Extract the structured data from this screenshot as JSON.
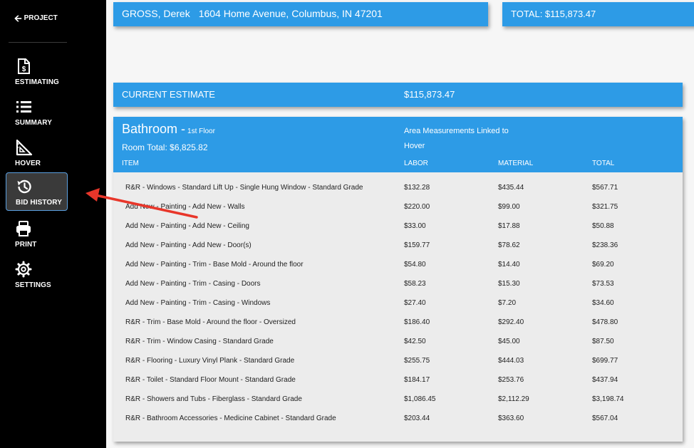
{
  "sidebar": {
    "back_label": "PROJECT",
    "items": [
      {
        "label": "ESTIMATING",
        "icon": "estimate-dollar-doc-icon",
        "active": false
      },
      {
        "label": "SUMMARY",
        "icon": "list-icon",
        "active": false
      },
      {
        "label": "HOVER",
        "icon": "ruler-triangle-icon",
        "active": false
      },
      {
        "label": "BID HISTORY",
        "icon": "history-clock-icon",
        "active": true
      },
      {
        "label": "PRINT",
        "icon": "printer-icon",
        "active": false
      },
      {
        "label": "SETTINGS",
        "icon": "gear-icon",
        "active": false
      }
    ]
  },
  "header": {
    "customer_name": "GROSS, Derek",
    "customer_address": "1604 Home Avenue, Columbus, IN 47201",
    "total_label": "TOTAL: $115,873.47"
  },
  "current_estimate": {
    "label": "CURRENT ESTIMATE",
    "value": "$115,873.47"
  },
  "room": {
    "name": "Bathroom -",
    "floor": "1st Floor",
    "total_label": "Room Total: $6,825.82",
    "area_note": "Area Measurements Linked to Hover",
    "columns": {
      "item": "ITEM",
      "labor": "LABOR",
      "material": "MATERIAL",
      "total": "TOTAL"
    },
    "rows": [
      {
        "item": "R&R - Windows - Standard Lift Up - Single Hung Window - Standard Grade",
        "labor": "$132.28",
        "material": "$435.44",
        "total": "$567.71"
      },
      {
        "item": "Add New - Painting - Add New - Walls",
        "labor": "$220.00",
        "material": "$99.00",
        "total": "$321.75"
      },
      {
        "item": "Add New - Painting - Add New - Ceiling",
        "labor": "$33.00",
        "material": "$17.88",
        "total": "$50.88"
      },
      {
        "item": "Add New - Painting - Add New - Door(s)",
        "labor": "$159.77",
        "material": "$78.62",
        "total": "$238.36"
      },
      {
        "item": "Add New - Painting - Trim - Base Mold - Around the floor",
        "labor": "$54.80",
        "material": "$14.40",
        "total": "$69.20"
      },
      {
        "item": "Add New - Painting - Trim - Casing - Doors",
        "labor": "$58.23",
        "material": "$15.30",
        "total": "$73.53"
      },
      {
        "item": "Add New - Painting - Trim - Casing - Windows",
        "labor": "$27.40",
        "material": "$7.20",
        "total": "$34.60"
      },
      {
        "item": "R&R - Trim - Base Mold - Around the floor - Oversized",
        "labor": "$186.40",
        "material": "$292.40",
        "total": "$478.80"
      },
      {
        "item": "R&R - Trim - Window Casing - Standard Grade",
        "labor": "$42.50",
        "material": "$45.00",
        "total": "$87.50"
      },
      {
        "item": "R&R - Flooring - Luxury Vinyl Plank - Standard Grade",
        "labor": "$255.75",
        "material": "$444.03",
        "total": "$699.77"
      },
      {
        "item": "R&R - Toilet - Standard Floor Mount - Standard Grade",
        "labor": "$184.17",
        "material": "$253.76",
        "total": "$437.94"
      },
      {
        "item": "R&R - Showers and Tubs - Fiberglass - Standard Grade",
        "labor": "$1,086.45",
        "material": "$2,112.29",
        "total": "$3,198.74"
      },
      {
        "item": "R&R - Bathroom Accessories - Medicine Cabinet - Standard Grade",
        "labor": "$203.44",
        "material": "$363.60",
        "total": "$567.04"
      }
    ]
  },
  "colors": {
    "sidebar_bg": "#000000",
    "accent_blue": "#2d9be6",
    "annotation_arrow": "#e8362a"
  }
}
